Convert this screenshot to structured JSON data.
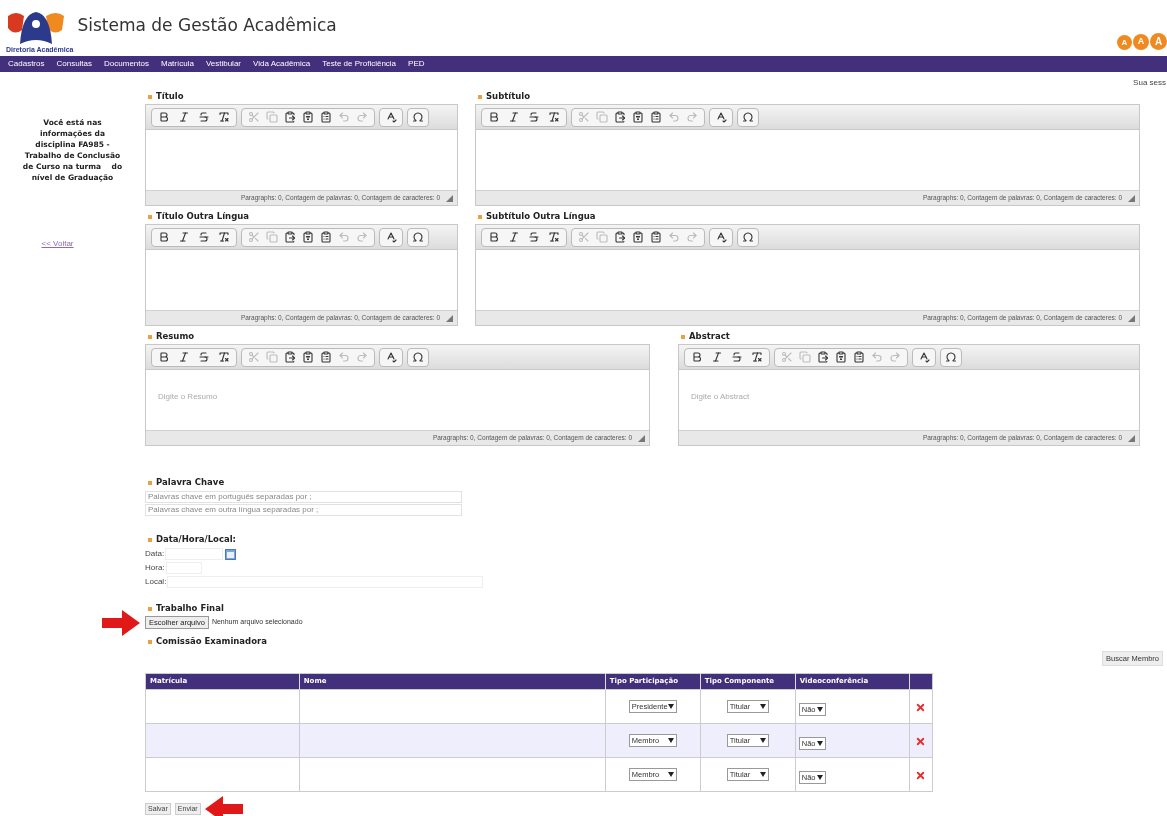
{
  "header": {
    "logo_caption": "Diretoria Acadêmica",
    "title": "Sistema de Gestão Acadêmica",
    "font_size_buttons": [
      "A",
      "A",
      "A"
    ]
  },
  "nav": [
    "Cadastros",
    "Consultas",
    "Documentos",
    "Matrícula",
    "Vestibular",
    "Vida Acadêmica",
    "Teste de Proficiência",
    "PED"
  ],
  "session_notice": "Sua sess",
  "sidebar": {
    "info": "Você está nas informações da disciplina FA985 - Trabalho de Conclusão de Curso na turma    do nível de Graduação",
    "back_link": "<< Voltar"
  },
  "editor_rows": [
    [
      {
        "label": "Título",
        "status": "Paragraphs: 0, Contagem de palavras: 0, Contagem de caracteres: 0"
      },
      {
        "label": "Subtítulo",
        "status": "Paragraphs: 0, Contagem de palavras: 0, Contagem de caracteres: 0"
      }
    ],
    [
      {
        "label": "Título Outra Língua",
        "status": "Paragraphs: 0, Contagem de palavras: 0, Contagem de caracteres: 0"
      },
      {
        "label": "Subtítulo Outra Língua",
        "status": "Paragraphs: 0, Contagem de palavras: 0, Contagem de caracteres: 0"
      }
    ],
    [
      {
        "label": "Resumo",
        "placeholder": "Digite o Resumo",
        "status": "Paragraphs: 0, Contagem de palavras: 0, Contagem de caracteres: 0"
      },
      {
        "label": "Abstract",
        "placeholder": "Digite o Abstract",
        "status": "Paragraphs: 0, Contagem de palavras: 0, Contagem de caracteres: 0"
      }
    ]
  ],
  "keywords": {
    "label": "Palavra Chave",
    "fields": [
      {
        "placeholder": "Palavras chave em português separadas por ;"
      },
      {
        "placeholder": "Palavras chave em outra língua separadas por ;"
      }
    ]
  },
  "schedule": {
    "label": "Data/Hora/Local:",
    "fields": [
      {
        "kind": "date",
        "label": "Data:"
      },
      {
        "kind": "time",
        "label": "Hora:"
      },
      {
        "kind": "place",
        "label": "Local:"
      }
    ]
  },
  "final_work": {
    "label": "Trabalho Final",
    "button": "Escolher arquivo",
    "status": "Nenhum arquivo selecionado"
  },
  "committee": {
    "label": "Comissão Examinadora",
    "search_button": "Buscar Membro",
    "columns": [
      "Matrícula",
      "Nome",
      "Tipo Participação",
      "Tipo Componente",
      "Videoconferência"
    ],
    "rows": [
      {
        "participation": "Presidente",
        "component": "Titular",
        "video": "Não"
      },
      {
        "participation": "Membro",
        "component": "Titular",
        "video": "Não"
      },
      {
        "participation": "Membro",
        "component": "Titular",
        "video": "Não"
      }
    ]
  },
  "actions": [
    "Salvar",
    "Enviar"
  ]
}
